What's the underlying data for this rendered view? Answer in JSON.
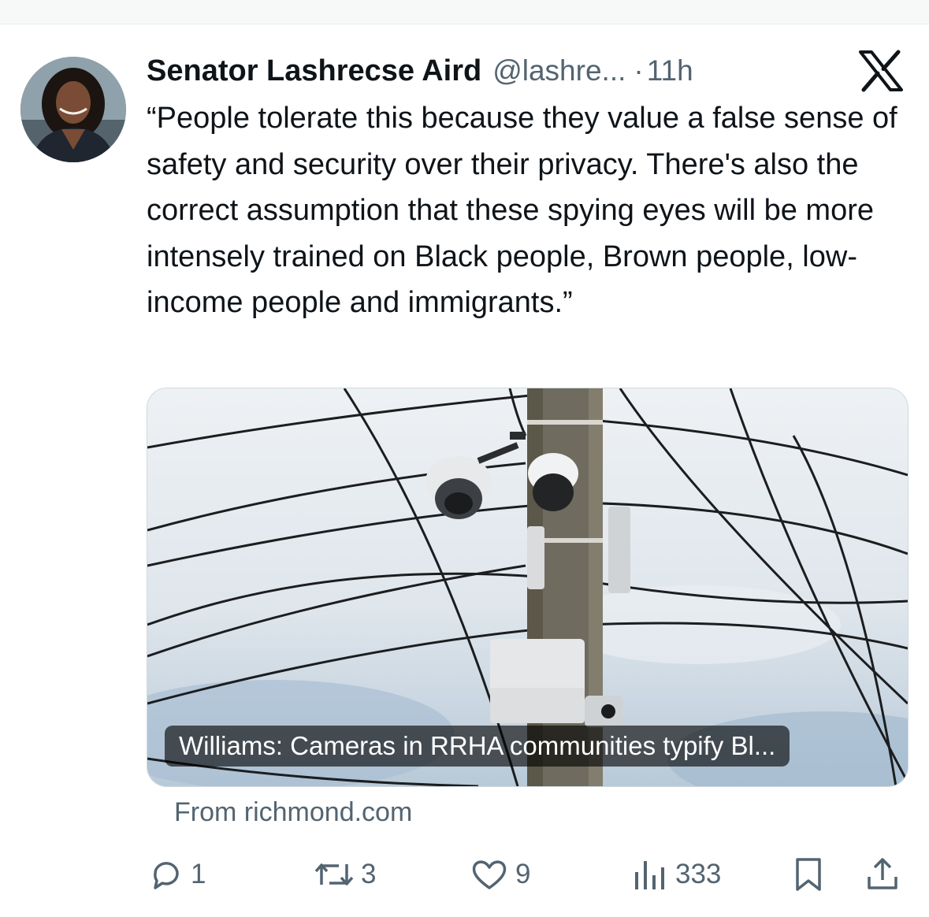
{
  "tweet": {
    "author_name": "Senator Lashrecse Aird",
    "handle": "@lashre...",
    "separator": "·",
    "time": "11h",
    "platform_icon": "x-logo-icon",
    "text": "“People tolerate this because they value a false sense of safety and security over their privacy. There's also the correct assumption that these spying eyes will be more intensely trained on Black people, Brown people, low-income people and immigrants.”"
  },
  "card": {
    "caption": "Williams: Cameras in RRHA communities typify Bl...",
    "source": "From richmond.com",
    "image_icon": "surveillance-cameras-on-utility-pole-photo"
  },
  "actions": {
    "reply": {
      "icon": "reply-icon",
      "count": "1"
    },
    "repost": {
      "icon": "repost-icon",
      "count": "3"
    },
    "like": {
      "icon": "heart-icon",
      "count": "9"
    },
    "views": {
      "icon": "views-chart-icon",
      "count": "333"
    },
    "bookmark": {
      "icon": "bookmark-icon"
    },
    "share": {
      "icon": "share-icon"
    }
  },
  "colors": {
    "text_primary": "#0f1419",
    "text_secondary": "#536471",
    "card_border": "#cfd9de",
    "caption_bg": "rgba(0,0,0,0.62)"
  }
}
